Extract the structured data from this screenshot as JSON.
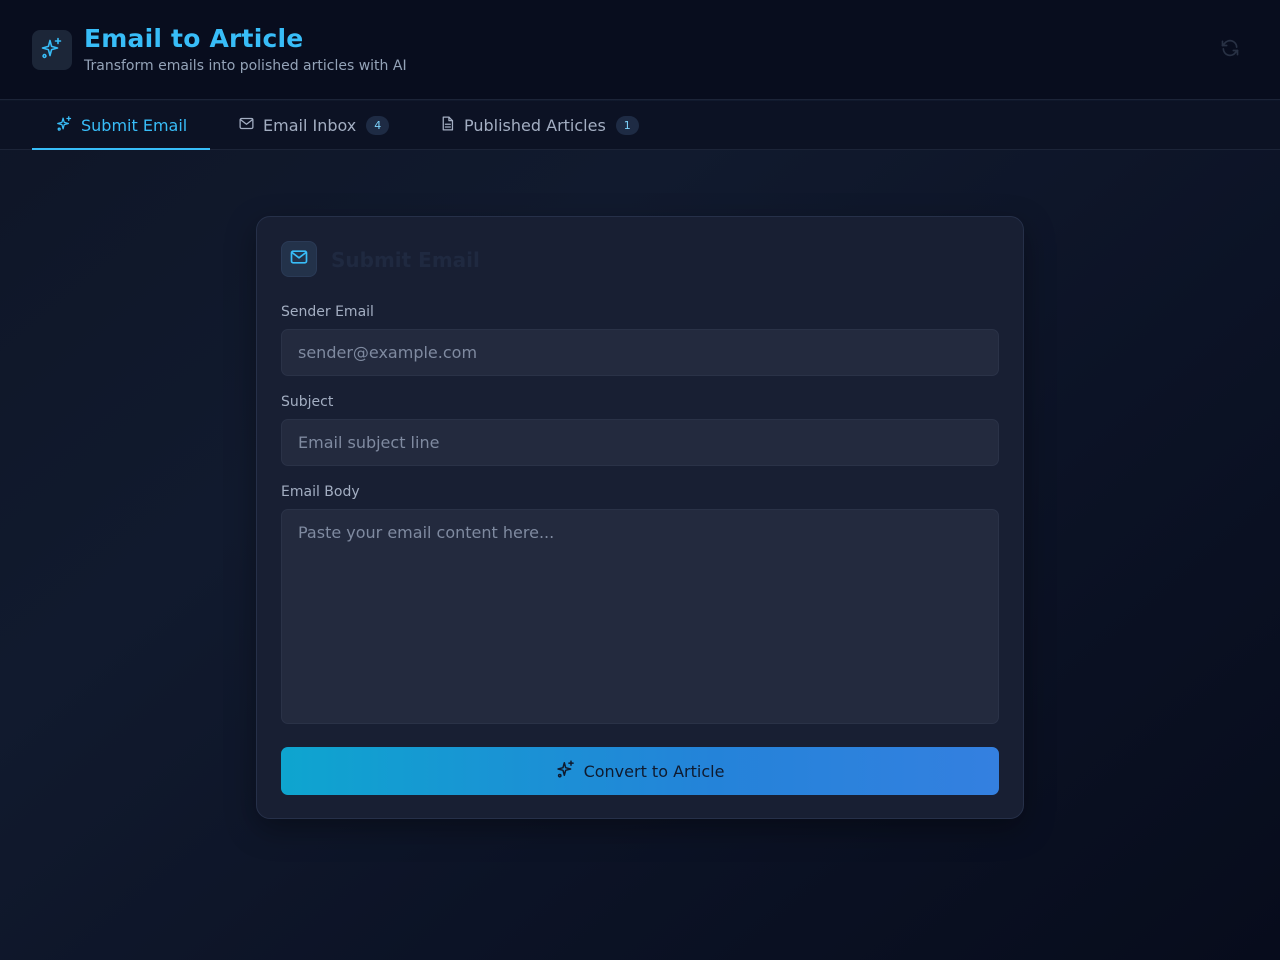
{
  "header": {
    "title": "Email to Article",
    "subtitle": "Transform emails into polished articles with AI",
    "logo_icon": "sparkles-icon",
    "refresh_icon": "refresh-icon"
  },
  "tabs": [
    {
      "label": "Submit Email",
      "icon": "sparkles-icon",
      "active": true
    },
    {
      "label": "Email Inbox",
      "icon": "mail-icon",
      "badge": "4"
    },
    {
      "label": "Published Articles",
      "icon": "document-icon",
      "badge": "1"
    }
  ],
  "form": {
    "title": "Submit Email",
    "icon": "mail-icon",
    "sender_label": "Sender Email",
    "sender_placeholder": "sender@example.com",
    "subject_label": "Subject",
    "subject_placeholder": "Email subject line",
    "body_label": "Email Body",
    "body_placeholder": "Paste your email content here...",
    "submit_label": "Convert to Article"
  },
  "colors": {
    "accent": "#38bdf8",
    "button_gradient_start": "#0ea5cf",
    "button_gradient_end": "#3480e0",
    "background": "#0e1526"
  }
}
